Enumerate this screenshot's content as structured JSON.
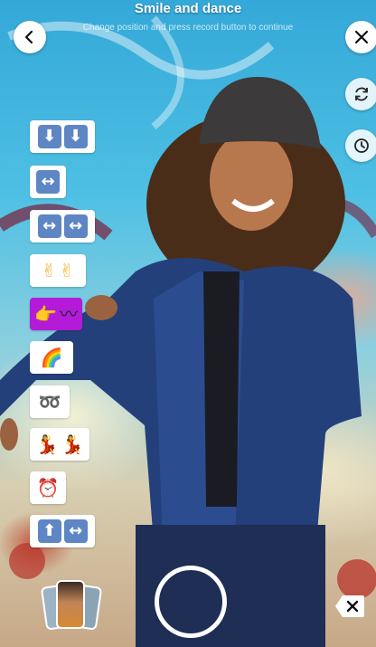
{
  "header": {
    "title": "Smile and dance",
    "subtitle": "Change position and press record  button to continue"
  },
  "icons": {
    "back": "chevron-left-icon",
    "close": "close-icon",
    "flip": "flip-camera-icon",
    "timer": "timer-icon",
    "delete": "backspace-icon"
  },
  "effects": [
    {
      "name": "down-down",
      "glyphs": [
        "⬇",
        "⬇"
      ]
    },
    {
      "name": "left-right",
      "glyphs": [
        "↔"
      ]
    },
    {
      "name": "left-right-double",
      "glyphs": [
        "↔",
        "↔"
      ]
    },
    {
      "name": "victory-hands",
      "glyphs": [
        "✌",
        "✌"
      ]
    },
    {
      "name": "point-right",
      "glyphs": [
        "👉",
        "〰"
      ],
      "selected": true
    },
    {
      "name": "rainbow",
      "glyphs": [
        "🌈"
      ]
    },
    {
      "name": "loop",
      "glyphs": [
        "➿"
      ]
    },
    {
      "name": "dancers",
      "glyphs": [
        "💃",
        "💃"
      ]
    },
    {
      "name": "alarm-clock",
      "glyphs": [
        "⏰"
      ]
    },
    {
      "name": "up-left-right",
      "glyphs": [
        "⬆",
        "↔"
      ]
    }
  ],
  "colors": {
    "accent": "#b31bd8",
    "arrow_key": "#5e86c4"
  }
}
